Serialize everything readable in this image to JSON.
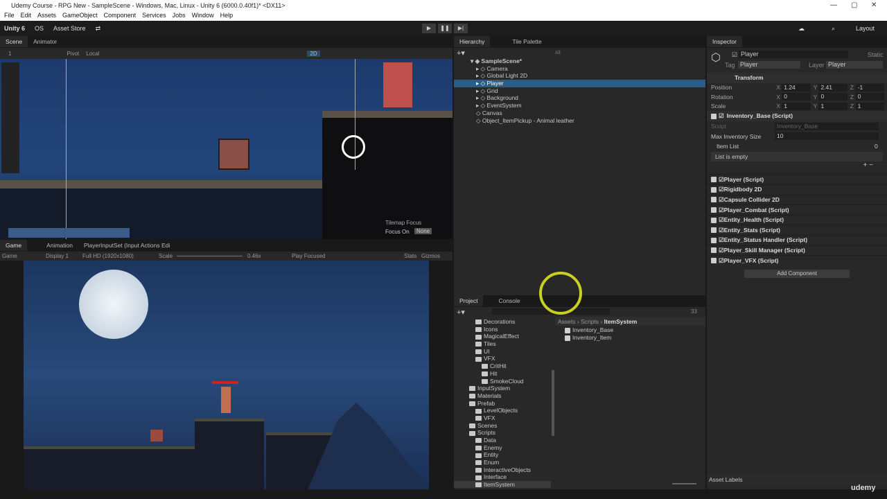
{
  "window": {
    "title": "Udemy Course - RPG New - SampleScene - Windows, Mac, Linux - Unity 6 (6000.0.40f1)* <DX11>"
  },
  "menu": [
    "File",
    "Edit",
    "Assets",
    "GameObject",
    "Component",
    "Services",
    "Jobs",
    "Window",
    "Help"
  ],
  "toolbar": {
    "account": "Unity 6",
    "os": "OS",
    "asset_store": "Asset Store",
    "layout": "Layout"
  },
  "scene": {
    "tabs": [
      "Scene",
      "Animator"
    ],
    "layer_num": "1",
    "pivot": "Pivot",
    "local": "Local",
    "mode2d": "2D",
    "tilemap_focus": "Tilemap Focus",
    "focus_on": "Focus On",
    "focus_value": "None"
  },
  "game": {
    "tabs": [
      "Game",
      "Animation",
      "PlayerInputSet (Input Actions Edi"
    ],
    "mode": "Game",
    "display": "Display 1",
    "resolution": "Full HD (1920x1080)",
    "scale_label": "Scale",
    "scale": "0.46x",
    "play_focused": "Play Focused",
    "stats": "Stats",
    "gizmos": "Gizmos"
  },
  "hierarchy": {
    "tabs": [
      "Hierarchy",
      "Tile Palette"
    ],
    "search_placeholder": "All",
    "scene": "SampleScene*",
    "items": [
      "Camera",
      "Global Light 2D",
      "Player",
      "Grid",
      "Background",
      "EventSystem",
      "Canvas",
      "Object_ItemPickup - Animal leather"
    ]
  },
  "inspector": {
    "tab": "Inspector",
    "object": "Player",
    "static": "Static",
    "tag_label": "Tag",
    "tag": "Player",
    "layer_label": "Layer",
    "layer": "Player",
    "transform": {
      "title": "Transform",
      "position": "Position",
      "rotation": "Rotation",
      "scale": "Scale",
      "px": "1.24",
      "py": "2.41",
      "pz": "-1",
      "rx": "0",
      "ry": "0",
      "rz": "0",
      "sx": "1",
      "sy": "1",
      "sz": "1",
      "X": "X",
      "Y": "Y",
      "Z": "Z"
    },
    "inventory": {
      "title": "Inventory_Base (Script)",
      "script_label": "Script",
      "script": "Inventory_Base",
      "max_label": "Max Inventory Size",
      "max": "10",
      "list_label": "Item List",
      "list_count": "0",
      "empty": "List is empty"
    },
    "components": [
      "Player (Script)",
      "Rigidbody 2D",
      "Capsule Collider 2D",
      "Player_Combat (Script)",
      "Entity_Health (Script)",
      "Entity_Stats (Script)",
      "Entity_Status Handler (Script)",
      "Player_Skill Manager (Script)",
      "Player_VFX (Script)"
    ],
    "add_component": "Add Component",
    "asset_labels": "Asset Labels"
  },
  "project": {
    "tabs": [
      "Project",
      "Console"
    ],
    "hidden_count": "33",
    "breadcrumb": [
      "Assets",
      "Scripts",
      "ItemSystem"
    ],
    "tree": [
      {
        "n": "Decorations",
        "d": 1
      },
      {
        "n": "Icons",
        "d": 1
      },
      {
        "n": "MagicalEffect",
        "d": 1
      },
      {
        "n": "Tiles",
        "d": 1
      },
      {
        "n": "UI",
        "d": 1
      },
      {
        "n": "VFX",
        "d": 1
      },
      {
        "n": "CritHit",
        "d": 2
      },
      {
        "n": "Hit",
        "d": 2
      },
      {
        "n": "SmokeCloud",
        "d": 2
      },
      {
        "n": "InputSystem",
        "d": 0
      },
      {
        "n": "Materials",
        "d": 0
      },
      {
        "n": "Prefab",
        "d": 0
      },
      {
        "n": "LevelObjects",
        "d": 1
      },
      {
        "n": "VFX",
        "d": 1
      },
      {
        "n": "Scenes",
        "d": 0
      },
      {
        "n": "Scripts",
        "d": 0
      },
      {
        "n": "Data",
        "d": 1
      },
      {
        "n": "Enemy",
        "d": 1
      },
      {
        "n": "Entity",
        "d": 1
      },
      {
        "n": "Enum",
        "d": 1
      },
      {
        "n": "InteractiveObjects",
        "d": 1
      },
      {
        "n": "Interface",
        "d": 1
      },
      {
        "n": "ItemSystem",
        "d": 1
      }
    ],
    "files": [
      "Inventory_Base",
      "Inventory_Item"
    ]
  },
  "watermark": "udemy"
}
